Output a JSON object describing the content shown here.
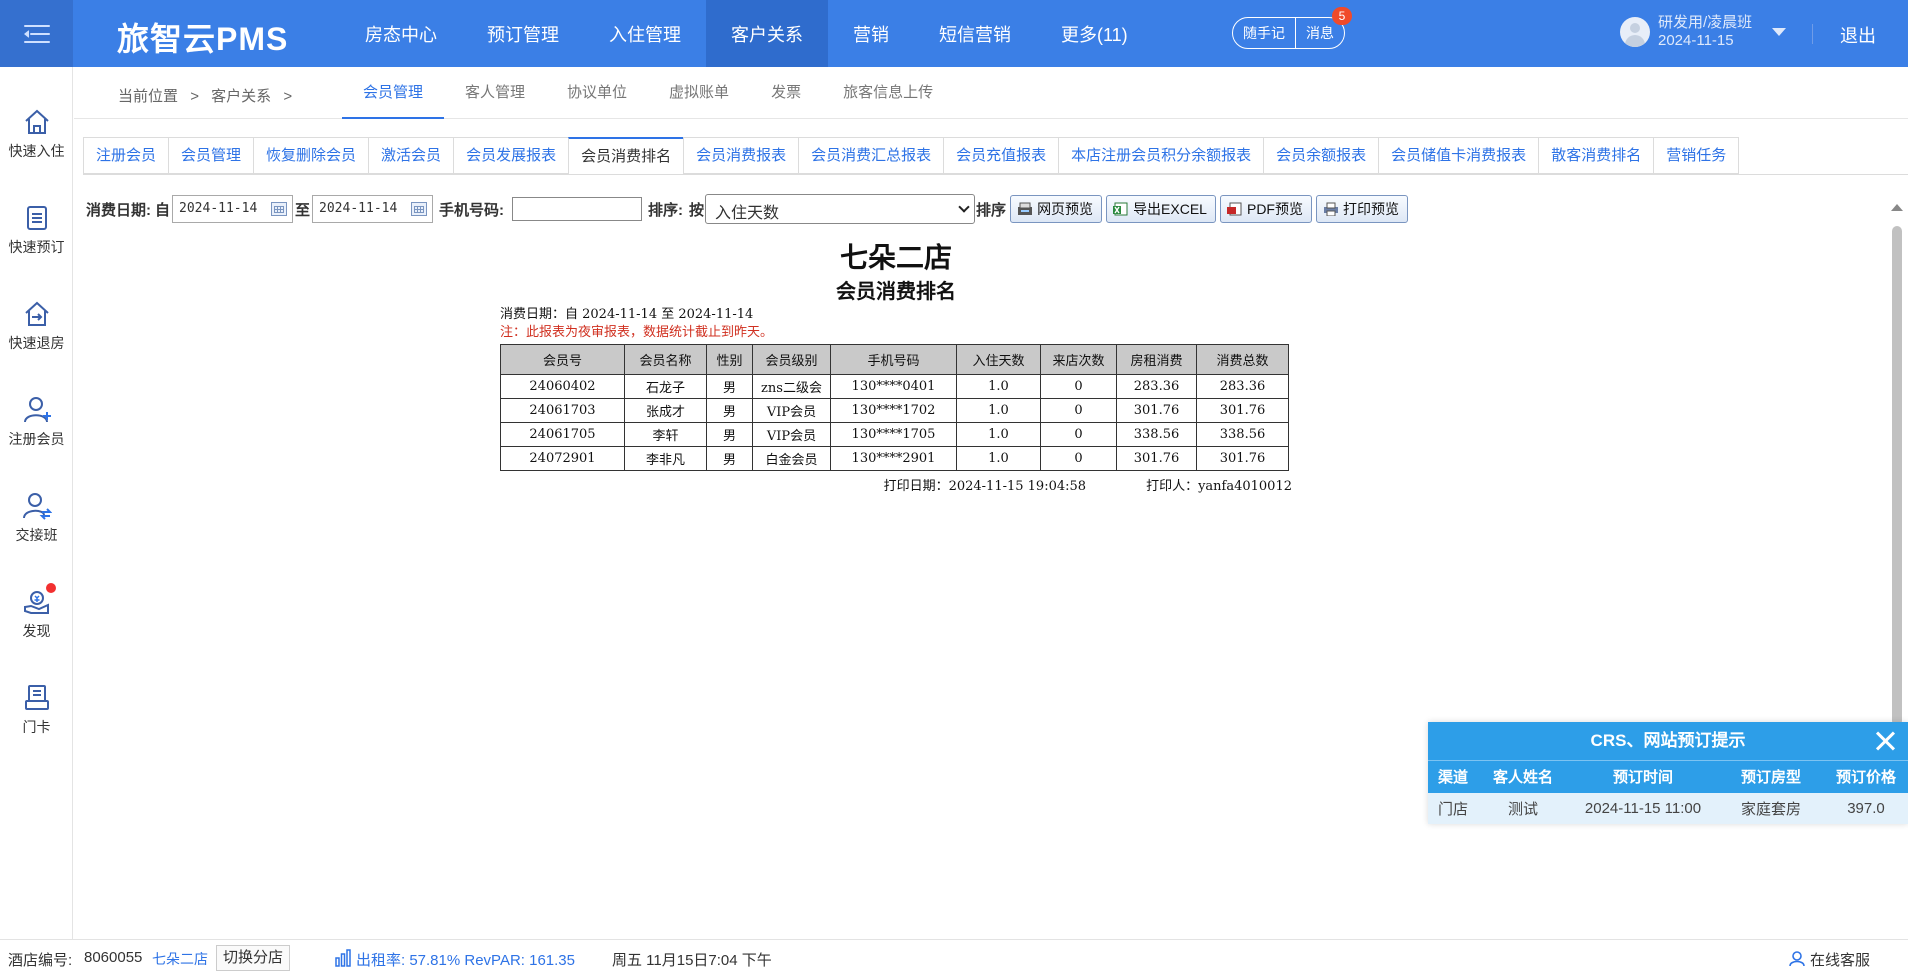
{
  "app": {
    "logo": "旅智云PMS",
    "logout": "退出"
  },
  "nav": [
    "房态中心",
    "预订管理",
    "入住管理",
    "客户关系",
    "营销",
    "短信营销",
    "更多(11)"
  ],
  "pills": {
    "note": "随手记",
    "message": "消息",
    "badge": "5"
  },
  "user": {
    "name": "研发用/凌晨班",
    "date": "2024-11-15"
  },
  "sidebar": [
    {
      "label": "快速入住",
      "icon": "home-icon"
    },
    {
      "label": "快速预订",
      "icon": "book-icon"
    },
    {
      "label": "快速退房",
      "icon": "checkout-icon"
    },
    {
      "label": "注册会员",
      "icon": "add-user-icon"
    },
    {
      "label": "交接班",
      "icon": "shift-icon"
    },
    {
      "label": "发现",
      "icon": "discover-icon"
    },
    {
      "label": "门卡",
      "icon": "card-icon"
    }
  ],
  "breadcrumb": {
    "label": "当前位置",
    "sep": ">",
    "section": "客户关系",
    "sep2": ">"
  },
  "subnav": [
    "会员管理",
    "客人管理",
    "协议单位",
    "虚拟账单",
    "发票",
    "旅客信息上传"
  ],
  "tabs": [
    "注册会员",
    "会员管理",
    "恢复删除会员",
    "激活会员",
    "会员发展报表",
    "会员消费排名",
    "会员消费报表",
    "会员消费汇总报表",
    "会员充值报表",
    "本店注册会员积分余额报表",
    "会员余额报表",
    "会员储值卡消费报表",
    "散客消费排名",
    "营销任务"
  ],
  "filter": {
    "date_label": "消费日期:",
    "from_label": "自",
    "from": "2024-11-14",
    "to_label": "至",
    "to": "2024-11-14",
    "phone_label": "手机号码:",
    "phone": "",
    "sort_label": "排序:",
    "by_label": "按",
    "sort_value": "入住天数",
    "sort_suffix": "排序",
    "btn_preview": "网页预览",
    "btn_excel": "导出EXCEL",
    "btn_pdf": "PDF预览",
    "btn_print": "打印预览"
  },
  "report": {
    "hotel": "七朵二店",
    "title": "会员消费排名",
    "range": "消费日期：自 2024-11-14 至 2024-11-14",
    "note": "注：此报表为夜审报表，数据统计截止到昨天。",
    "columns": [
      "会员号",
      "会员名称",
      "性别",
      "会员级别",
      "手机号码",
      "入住天数",
      "来店次数",
      "房租消费",
      "消费总数"
    ],
    "rows": [
      [
        "24060402",
        "石龙子",
        "男",
        "zns二级会",
        "130****0401",
        "1.0",
        "0",
        "283.36",
        "283.36"
      ],
      [
        "24061703",
        "张成才",
        "男",
        "VIP会员",
        "130****1702",
        "1.0",
        "0",
        "301.76",
        "301.76"
      ],
      [
        "24061705",
        "李轩",
        "男",
        "VIP会员",
        "130****1705",
        "1.0",
        "0",
        "338.56",
        "338.56"
      ],
      [
        "24072901",
        "李非凡",
        "男",
        "白金会员",
        "130****2901",
        "1.0",
        "0",
        "301.76",
        "301.76"
      ]
    ],
    "print_date": "打印日期：2024-11-15 19:04:58",
    "printer": "打印人：yanfa4010012"
  },
  "crs": {
    "title": "CRS、网站预订提示",
    "columns": [
      "渠道",
      "客人姓名",
      "预订时间",
      "预订房型",
      "预订价格"
    ],
    "rows": [
      [
        "门店",
        "测试",
        "2024-11-15 11:00",
        "家庭套房",
        "397.0"
      ]
    ]
  },
  "status": {
    "hotel_no_label": "酒店编号:",
    "hotel_no": "8060055",
    "hotel_name": "七朵二店",
    "switch": "切换分店",
    "occupancy": "出租率: 57.81% RevPAR: 161.35",
    "datetime": "周五 11月15日7:04 下午",
    "service": "在线客服"
  },
  "colors": {
    "primary": "#3b7fe6",
    "active_nav": "#2f6ccd",
    "crs_head": "#2d9ee8",
    "link": "#2e73e6"
  }
}
